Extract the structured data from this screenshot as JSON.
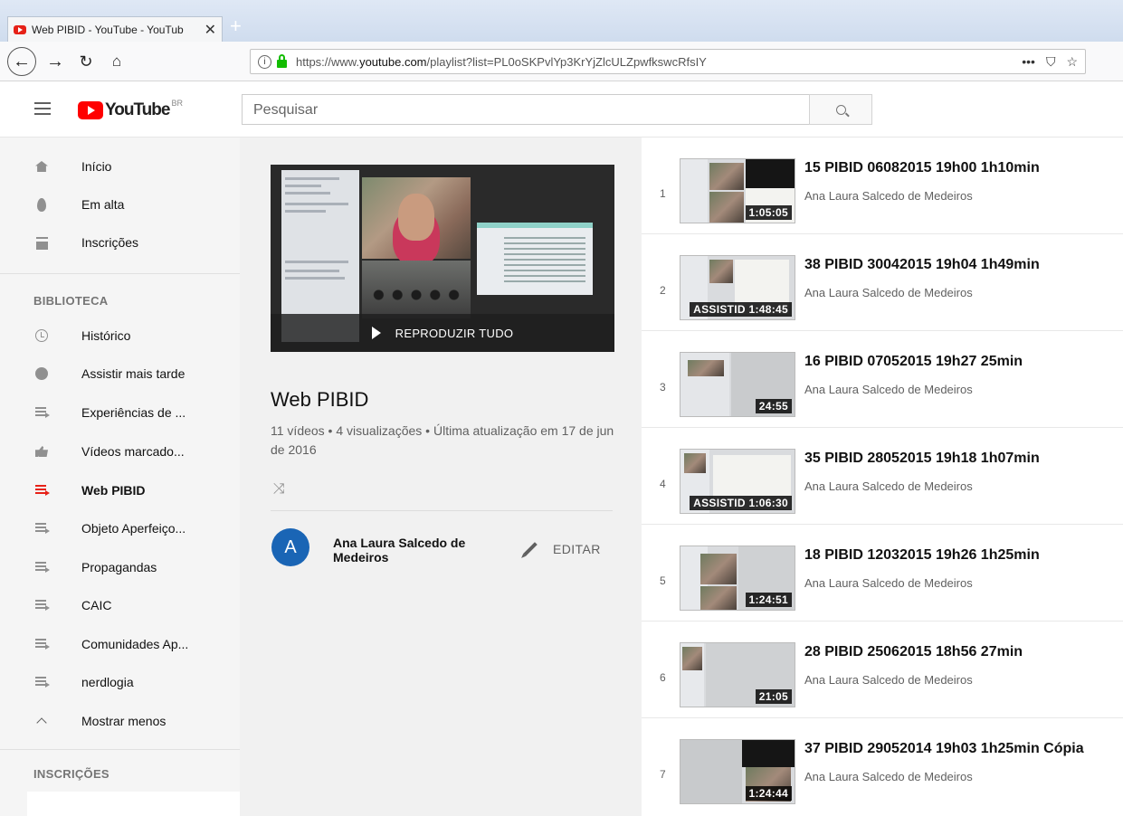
{
  "browser": {
    "tab_title": "Web PIBID - YouTube - YouTub",
    "tab_close": "✕",
    "new_tab": "+",
    "url_prefix": "https://www.",
    "url_host": "youtube.com",
    "url_path": "/playlist?list=PL0oSKPvlYp3KrYjZlcULZpwfkswcRfsIY",
    "more_icon": "•••"
  },
  "masthead": {
    "logo_text": "YouTube",
    "country": "BR",
    "search_placeholder": "Pesquisar"
  },
  "sidebar": {
    "top_items": [
      {
        "label": "Início",
        "icon": "home-icon"
      },
      {
        "label": "Em alta",
        "icon": "fire-icon"
      },
      {
        "label": "Inscrições",
        "icon": "subscriptions-icon"
      }
    ],
    "library_heading": "BIBLIOTECA",
    "library_items": [
      {
        "label": "Histórico",
        "icon": "history-icon"
      },
      {
        "label": "Assistir mais tarde",
        "icon": "watch-later-icon"
      },
      {
        "label": "Experiências de ...",
        "icon": "playlist-icon"
      },
      {
        "label": "Vídeos marcado...",
        "icon": "like-icon"
      },
      {
        "label": "Web PIBID",
        "icon": "playlist-icon",
        "active": true
      },
      {
        "label": "Objeto Aperfeiço...",
        "icon": "playlist-icon"
      },
      {
        "label": "Propagandas",
        "icon": "playlist-icon"
      },
      {
        "label": "CAIC",
        "icon": "playlist-icon"
      },
      {
        "label": "Comunidades Ap...",
        "icon": "playlist-icon"
      },
      {
        "label": "nerdlogia",
        "icon": "playlist-icon"
      },
      {
        "label": "Mostrar menos",
        "icon": "chevron-up-icon"
      }
    ],
    "subscriptions_heading": "INSCRIÇÕES"
  },
  "playlist": {
    "play_all_label": "REPRODUZIR TUDO",
    "title": "Web PIBID",
    "stats": "11 vídeos • 4 visualizações • Última atualização em 17 de jun de 2016",
    "owner_initial": "A",
    "owner_name": "Ana Laura Salcedo de Medeiros",
    "edit_label": "EDITAR"
  },
  "videos": [
    {
      "index": "1",
      "title": "15 PIBID 06082015 19h00 1h10min",
      "owner": "Ana Laura Salcedo de Medeiros",
      "duration": "1:05:05"
    },
    {
      "index": "2",
      "title": "38 PIBID 30042015 19h04 1h49min",
      "owner": "Ana Laura Salcedo de Medeiros",
      "duration": "ASSISTID 1:48:45"
    },
    {
      "index": "3",
      "title": "16 PIBID 07052015 19h27 25min",
      "owner": "Ana Laura Salcedo de Medeiros",
      "duration": "24:55"
    },
    {
      "index": "4",
      "title": "35 PIBID 28052015 19h18 1h07min",
      "owner": "Ana Laura Salcedo de Medeiros",
      "duration": "ASSISTID 1:06:30"
    },
    {
      "index": "5",
      "title": "18 PIBID 12032015 19h26 1h25min",
      "owner": "Ana Laura Salcedo de Medeiros",
      "duration": "1:24:51"
    },
    {
      "index": "6",
      "title": "28 PIBID 25062015 18h56 27min",
      "owner": "Ana Laura Salcedo de Medeiros",
      "duration": "21:05"
    },
    {
      "index": "7",
      "title": "37 PIBID 29052014 19h03 1h25min Cópia",
      "owner": "Ana Laura Salcedo de Medeiros",
      "duration": "1:24:44"
    }
  ],
  "colors": {
    "accent_red": "#e62117",
    "avatar_blue": "#1a65b5"
  }
}
